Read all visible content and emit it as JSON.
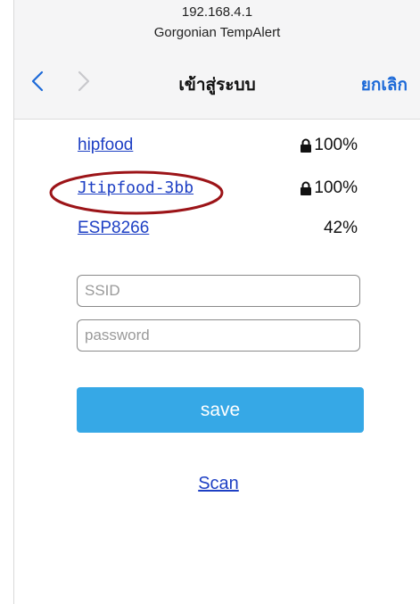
{
  "header": {
    "ip": "192.168.4.1",
    "subtitle": "Gorgonian TempAlert"
  },
  "nav": {
    "title": "เข้าสู่ระบบ",
    "cancel_label": "ยกเลิก",
    "back_icon": "chevron-left-icon",
    "forward_icon": "chevron-right-icon"
  },
  "networks": [
    {
      "ssid": "hipfood",
      "signal": "100%",
      "locked": true
    },
    {
      "ssid": "Jtipfood-3bb",
      "signal": "100%",
      "locked": true,
      "highlighted": true
    },
    {
      "ssid": "ESP8266",
      "signal": "42%",
      "locked": false
    }
  ],
  "form": {
    "ssid_placeholder": "SSID",
    "ssid_value": "",
    "password_placeholder": "password",
    "password_value": "",
    "save_label": "save",
    "scan_label": "Scan"
  },
  "colors": {
    "link": "#1d3fc4",
    "accent": "#1d6ad8",
    "button": "#36a8e6",
    "highlight": "#9c1418"
  }
}
